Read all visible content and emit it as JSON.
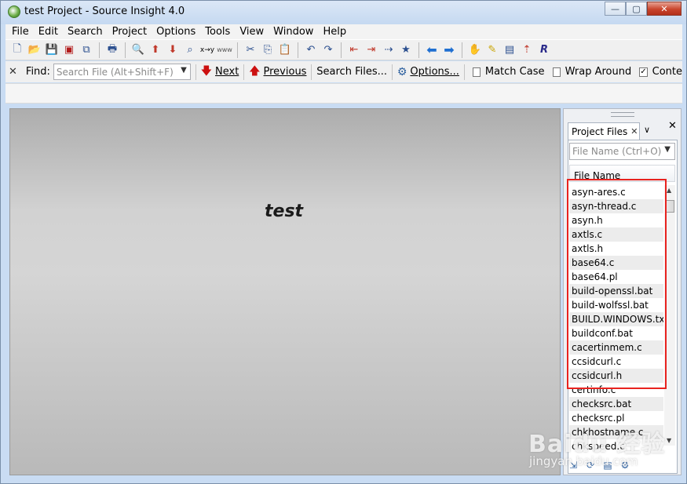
{
  "window": {
    "title": "test Project - Source Insight 4.0"
  },
  "window_buttons": {
    "minimize": "—",
    "maximize": "▢",
    "close": "✕"
  },
  "menu": [
    "File",
    "Edit",
    "Search",
    "Project",
    "Options",
    "Tools",
    "View",
    "Window",
    "Help"
  ],
  "toolbar_icons": [
    "new-file-icon",
    "open-folder-icon",
    "save-icon",
    "save-red-icon",
    "save-all-icon",
    "print-icon",
    "zoom-icon",
    "browse-up-icon",
    "browse-down-icon",
    "zoom-find-icon",
    "replace-icon",
    "www-icon",
    "cut-icon",
    "copy-icon",
    "paste-icon",
    "undo-icon",
    "redo-icon",
    "sync-left-icon",
    "sync-right-icon",
    "jump-icon",
    "bookmark-icon",
    "back-arrow-icon",
    "forward-arrow-icon",
    "symbol-icon",
    "note-icon",
    "document-icon",
    "relation-icon",
    "r-icon"
  ],
  "find_bar": {
    "close": "✕",
    "label": "Find:",
    "placeholder": "Search File (Alt+Shift+F)",
    "next": "Next",
    "previous": "Previous",
    "search_files": "Search Files...",
    "options": "Options...",
    "match_case": "Match Case",
    "wrap_around": "Wrap Around",
    "context": "Conte",
    "match_case_checked": false,
    "wrap_around_checked": false,
    "context_checked": true
  },
  "editor": {
    "title": "test"
  },
  "panel": {
    "tab_label": "Project Files",
    "tab_close": "✕",
    "menu_arrow": "∨",
    "close": "✕",
    "search_placeholder": "File Name (Ctrl+O)",
    "column_header": "File Name",
    "files": [
      "asyn-ares.c",
      "asyn-thread.c",
      "asyn.h",
      "axtls.c",
      "axtls.h",
      "base64.c",
      "base64.pl",
      "build-openssl.bat",
      "build-wolfssl.bat",
      "BUILD.WINDOWS.txt",
      "buildconf.bat",
      "cacertinmem.c",
      "ccsidcurl.c",
      "ccsidcurl.h",
      "certinfo.c",
      "checksrc.bat",
      "checksrc.pl",
      "chkhostname.c",
      "chkspeed.c"
    ]
  },
  "watermark": {
    "main": "Baidu 经验",
    "sub": "jingyan.baidu.com"
  }
}
